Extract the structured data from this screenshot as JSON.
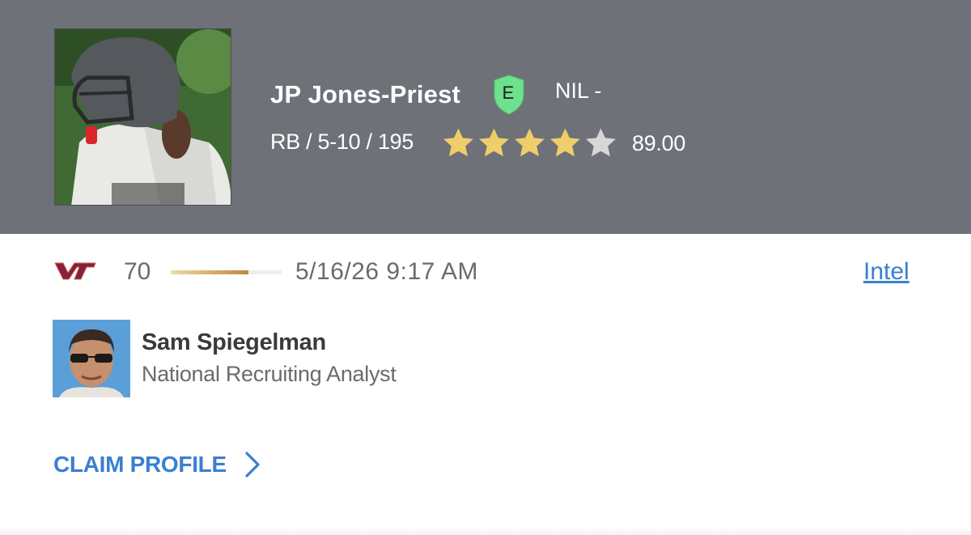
{
  "player": {
    "name": "JP Jones-Priest",
    "eval_badge": "E",
    "nil": "NIL -",
    "bio": "RB / 5-10 / 195",
    "stars": 4,
    "stars_max": 5,
    "rating": "89.00",
    "photo_icon": "player-photo"
  },
  "prediction": {
    "team_logo": "VT",
    "confidence": "70",
    "confidence_fraction": 0.7,
    "timestamp": "5/16/26 9:17 AM",
    "intel_label": "Intel"
  },
  "analyst": {
    "name": "Sam Spiegelman",
    "title": "National Recruiting Analyst",
    "photo_icon": "analyst-avatar"
  },
  "claim": {
    "label": "CLAIM PROFILE",
    "icon": "chevron-right-icon"
  },
  "colors": {
    "header_bg": "#6e7178",
    "link": "#3a7fd0",
    "star_gold": "#f0cd6b",
    "star_empty": "#d7d7d7",
    "badge_green": "#6fe08e",
    "vt_maroon": "#861f41"
  }
}
